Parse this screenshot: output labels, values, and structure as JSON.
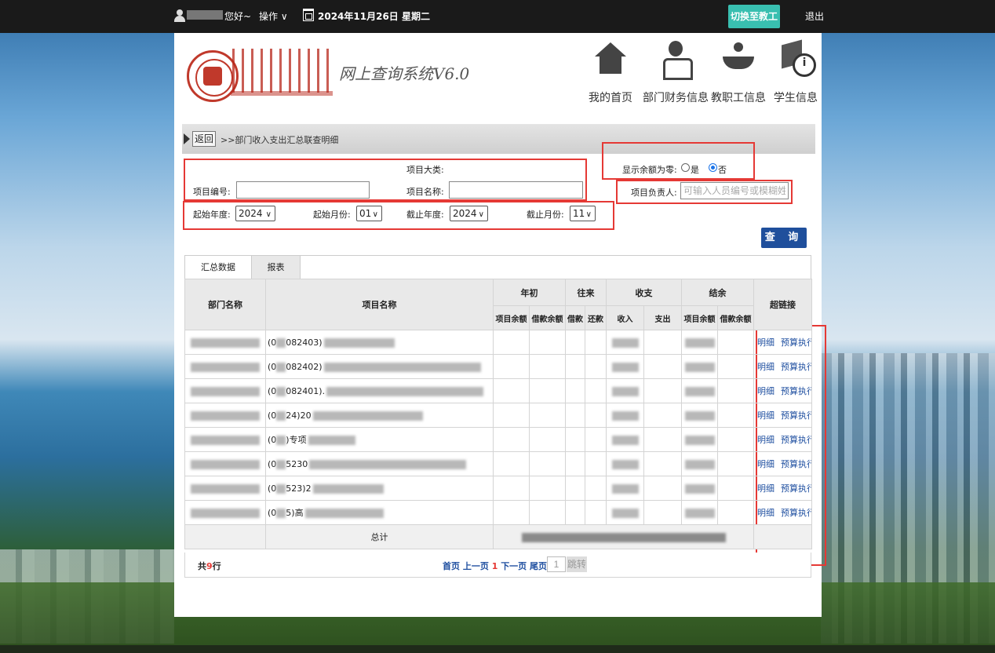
{
  "topbar": {
    "greeting": "您好~",
    "actions_label": "操作",
    "actions_arrow": "∨",
    "date": "2024年11月26日 星期二",
    "switch_label": "切换至教工",
    "logout_label": "退出"
  },
  "header": {
    "system_title": "网上查询系统V6.0",
    "nav": [
      {
        "label": "我的首页",
        "icon": "home-icon"
      },
      {
        "label": "部门财务信息",
        "icon": "department-user-icon"
      },
      {
        "label": "教职工信息",
        "icon": "staff-hand-icon"
      },
      {
        "label": "学生信息",
        "icon": "student-info-icon"
      }
    ]
  },
  "breadcrumb": {
    "back_label": "返回",
    "path": ">>部门收入支出汇总联查明细"
  },
  "filters": {
    "category_label": "项目大类:",
    "project_no_label": "项目编号:",
    "project_no_value": "",
    "project_name_label": "项目名称:",
    "project_name_value": "",
    "show_zero_label": "显示余额为零:",
    "yes_label": "是",
    "no_label": "否",
    "owner_label": "项目负责人:",
    "owner_placeholder": "可输入人员编号或模糊姓名",
    "start_year_label": "起始年度:",
    "start_year": "2024",
    "start_month_label": "起始月份:",
    "start_month": "01",
    "end_year_label": "截止年度:",
    "end_year": "2024",
    "end_month_label": "截止月份:",
    "end_month": "11",
    "query_label": "查 询"
  },
  "tabs": [
    "汇总数据",
    "报表"
  ],
  "table": {
    "headers": {
      "dept": "部门名称",
      "project": "项目名称",
      "opening": "年初",
      "opening_sub": [
        "项目余额",
        "借款余额"
      ],
      "transfer": "往来",
      "transfer_sub": [
        "借款",
        "还款"
      ],
      "income_expense": "收支",
      "income_expense_sub": [
        "收入",
        "支出"
      ],
      "balance": "结余",
      "balance_sub": [
        "项目余额",
        "借款余额"
      ],
      "links": "超链接"
    },
    "rows": [
      {
        "code": "(0",
        "code_rest": "082403)"
      },
      {
        "code": "(0",
        "code_rest": "082402)"
      },
      {
        "code": "(0",
        "code_rest": "082401)."
      },
      {
        "code": "(0",
        "code_rest": "24)20"
      },
      {
        "code": "(0",
        "code_rest": ")专项"
      },
      {
        "code": "(0",
        "code_rest": "5230"
      },
      {
        "code": "(0",
        "code_rest": "523)2"
      },
      {
        "code": "(0",
        "code_rest": "5)高"
      }
    ],
    "link_detail": "明细",
    "link_budget": "预算执行",
    "total_label": "总计"
  },
  "pager": {
    "count_prefix": "共",
    "count": "9",
    "count_suffix": "行",
    "first": "首页",
    "prev": "上一页",
    "current": "1",
    "next": "下一页",
    "last": "尾页",
    "page_value": "1",
    "go_label": "跳转"
  },
  "colors": {
    "accent": "#1f4f9c",
    "switch_button": "#39bfb0",
    "highlight_box": "#e53935"
  }
}
